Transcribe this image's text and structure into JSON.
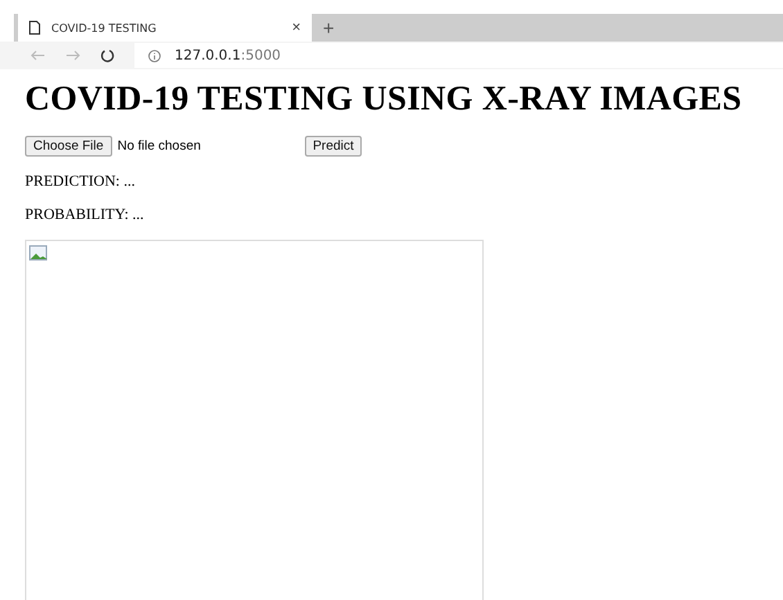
{
  "browser": {
    "tab_title": "COVID-19 TESTING",
    "tab_close": "×",
    "new_tab": "+",
    "url_host": "127.0.0.1",
    "url_port": ":5000"
  },
  "page": {
    "heading": "COVID-19 TESTING USING X-RAY IMAGES",
    "file_button": "Choose File",
    "file_status": "No file chosen",
    "predict_button": "Predict",
    "prediction": "PREDICTION: ...",
    "probability": "PROBABILITY: ..."
  }
}
